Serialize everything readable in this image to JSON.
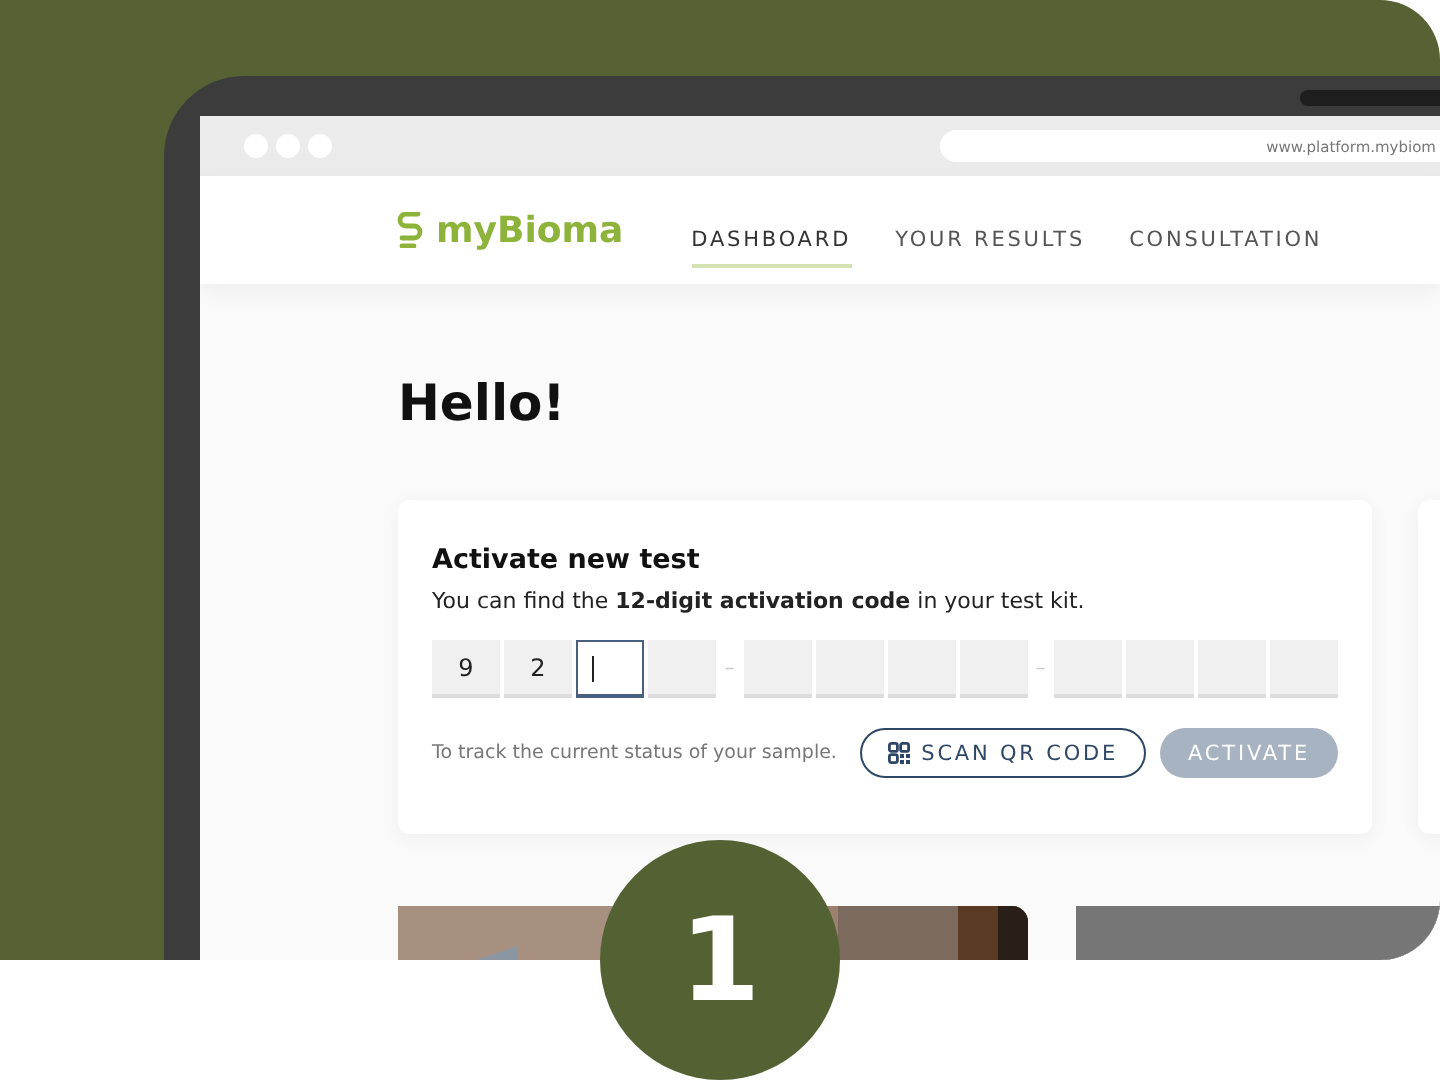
{
  "browser": {
    "url": "www.platform.mybiom"
  },
  "nav": {
    "logo": "myBioma",
    "items": [
      {
        "label": "DASHBOARD",
        "selected": true
      },
      {
        "label": "YOUR RESULTS",
        "selected": false
      },
      {
        "label": "CONSULTATION",
        "selected": false
      }
    ]
  },
  "greeting": "Hello!",
  "activation_card": {
    "title": "Activate new test",
    "description": "You can find the **12-digit activation code** in your test kit.",
    "code_groups": [
      {
        "cells": [
          {
            "value": "9",
            "focused": false
          },
          {
            "value": "2",
            "focused": false
          },
          {
            "focused": true
          },
          {
            "focused": false
          }
        ]
      },
      {
        "cells": [
          {
            "focused": false
          },
          {
            "focused": false
          },
          {
            "focused": false
          },
          {
            "focused": false
          }
        ]
      },
      {
        "cells": [
          {
            "focused": false
          },
          {
            "focused": false
          },
          {
            "focused": false
          },
          {
            "focused": false
          }
        ]
      }
    ],
    "separators": [
      "–",
      "–"
    ],
    "hint": "To track the current status of your sample.",
    "scan_button": "SCAN QR CODE",
    "activate_button": {
      "label": "ACTIVATE",
      "disabled": true
    }
  },
  "step_badge": "1"
}
